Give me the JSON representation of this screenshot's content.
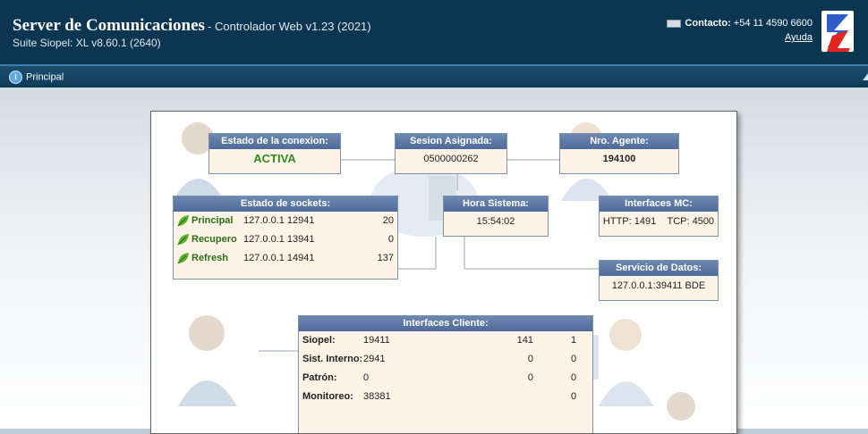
{
  "header": {
    "title": "Server de Comunicaciones",
    "subtitle": "- Controlador Web v1.23 (2021)",
    "suite": "Suite Siopel: XL v8.60.1 (2640)",
    "contact_label": "Contacto:",
    "contact_phone": "+54 11 4590 6600",
    "help": "Ayuda"
  },
  "nav": {
    "tab_principal": "Principal"
  },
  "estado_conexion": {
    "title": "Estado de la conexion:",
    "value": "ACTIVA",
    "value_color": "#2a8c1e"
  },
  "sesion": {
    "title": "Sesion Asignada:",
    "value": "0500000262"
  },
  "agente": {
    "title": "Nro. Agente:",
    "value": "194100"
  },
  "sockets": {
    "title": "Estado de sockets:",
    "rows": [
      {
        "name": "Principal",
        "addr": "127.0.0.1 12941",
        "count": "20"
      },
      {
        "name": "Recupero",
        "addr": "127.0.0.1 13941",
        "count": "0"
      },
      {
        "name": "Refresh",
        "addr": "127.0.0.1 14941",
        "count": "137"
      }
    ]
  },
  "hora": {
    "title": "Hora Sistema:",
    "value": "15:54:02"
  },
  "interfaces_mc": {
    "title": "Interfaces MC:",
    "http": "HTTP: 1491",
    "tcp": "TCP: 4500"
  },
  "servicio": {
    "title": "Servicio de Datos:",
    "value": "127.0.0.1:39411 BDE"
  },
  "clientes": {
    "title": "Interfaces Cliente:",
    "rows": [
      {
        "name": "Siopel:",
        "a": "19411",
        "b": "141",
        "c": "1"
      },
      {
        "name": "Sist. Interno:",
        "a": "2941",
        "b": "0",
        "c": "0"
      },
      {
        "name": "Patrón:",
        "a": "0",
        "b": "0",
        "c": "0"
      },
      {
        "name": "Monitoreo:",
        "a": "38381",
        "b": "",
        "c": "0"
      }
    ]
  }
}
